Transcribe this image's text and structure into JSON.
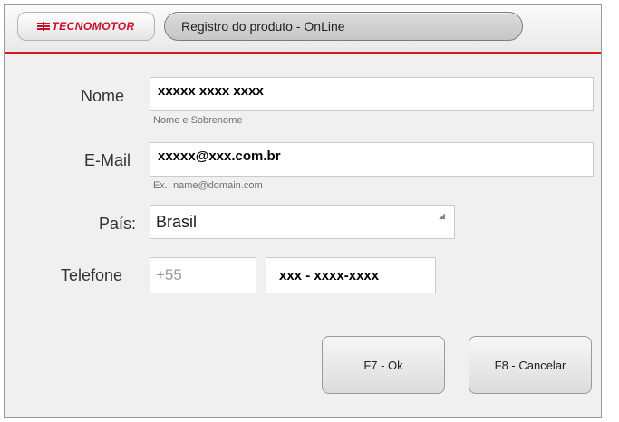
{
  "header": {
    "logo_text": "TECNOMOTOR",
    "title": "Registro do produto - OnLine"
  },
  "form": {
    "nome": {
      "label": "Nome",
      "value": "xxxxx xxxx xxxx",
      "hint": "Nome e Sobrenome"
    },
    "email": {
      "label": "E-Mail",
      "value": "xxxxx@xxx.com.br",
      "hint": "Ex.: name@domain.com"
    },
    "pais": {
      "label": "País:",
      "selected": "Brasil",
      "icon": "dropdown-grip-icon"
    },
    "telefone": {
      "label": "Telefone",
      "prefix": "+55",
      "number": "xxx - xxxx-xxxx"
    }
  },
  "buttons": {
    "ok": "F7 - Ok",
    "cancel": "F8 - Cancelar"
  },
  "colors": {
    "accent_red": "#d71920",
    "background": "#f0f0f0"
  }
}
